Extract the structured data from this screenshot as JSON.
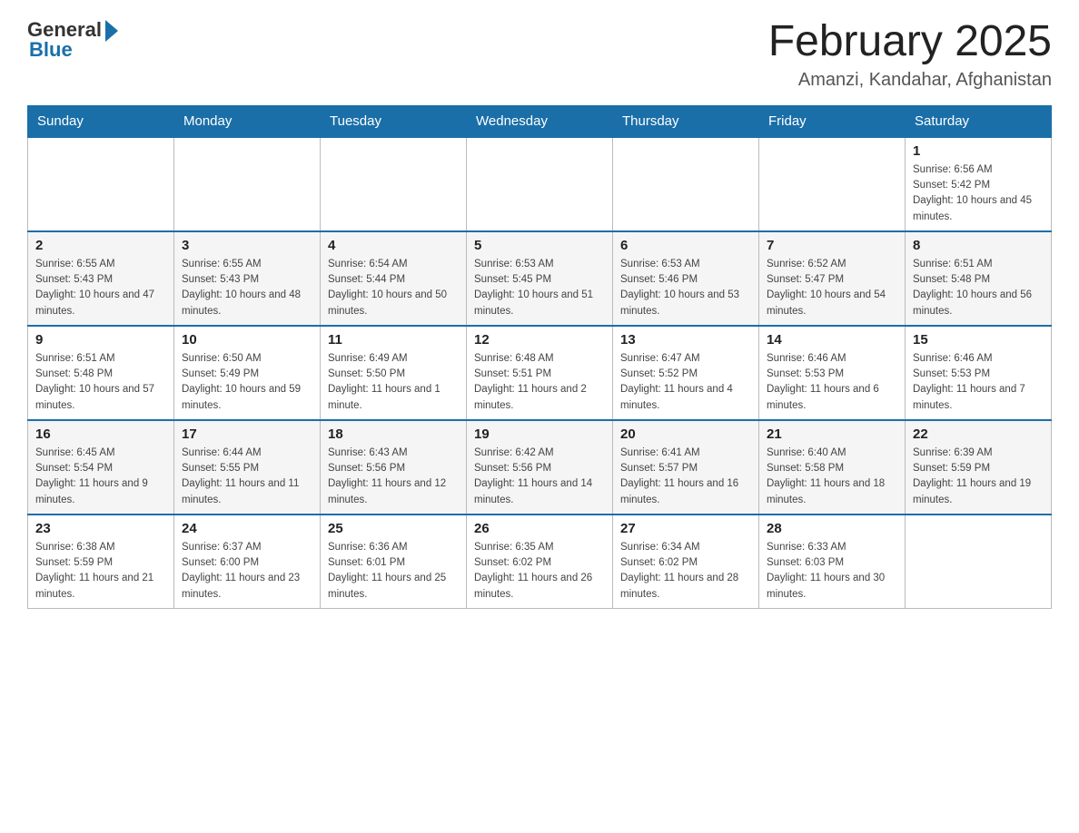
{
  "header": {
    "logo": {
      "general": "General",
      "blue": "Blue"
    },
    "title": "February 2025",
    "subtitle": "Amanzi, Kandahar, Afghanistan"
  },
  "days_of_week": [
    "Sunday",
    "Monday",
    "Tuesday",
    "Wednesday",
    "Thursday",
    "Friday",
    "Saturday"
  ],
  "weeks": [
    {
      "days": [
        {
          "number": "",
          "info": ""
        },
        {
          "number": "",
          "info": ""
        },
        {
          "number": "",
          "info": ""
        },
        {
          "number": "",
          "info": ""
        },
        {
          "number": "",
          "info": ""
        },
        {
          "number": "",
          "info": ""
        },
        {
          "number": "1",
          "info": "Sunrise: 6:56 AM\nSunset: 5:42 PM\nDaylight: 10 hours and 45 minutes."
        }
      ]
    },
    {
      "days": [
        {
          "number": "2",
          "info": "Sunrise: 6:55 AM\nSunset: 5:43 PM\nDaylight: 10 hours and 47 minutes."
        },
        {
          "number": "3",
          "info": "Sunrise: 6:55 AM\nSunset: 5:43 PM\nDaylight: 10 hours and 48 minutes."
        },
        {
          "number": "4",
          "info": "Sunrise: 6:54 AM\nSunset: 5:44 PM\nDaylight: 10 hours and 50 minutes."
        },
        {
          "number": "5",
          "info": "Sunrise: 6:53 AM\nSunset: 5:45 PM\nDaylight: 10 hours and 51 minutes."
        },
        {
          "number": "6",
          "info": "Sunrise: 6:53 AM\nSunset: 5:46 PM\nDaylight: 10 hours and 53 minutes."
        },
        {
          "number": "7",
          "info": "Sunrise: 6:52 AM\nSunset: 5:47 PM\nDaylight: 10 hours and 54 minutes."
        },
        {
          "number": "8",
          "info": "Sunrise: 6:51 AM\nSunset: 5:48 PM\nDaylight: 10 hours and 56 minutes."
        }
      ]
    },
    {
      "days": [
        {
          "number": "9",
          "info": "Sunrise: 6:51 AM\nSunset: 5:48 PM\nDaylight: 10 hours and 57 minutes."
        },
        {
          "number": "10",
          "info": "Sunrise: 6:50 AM\nSunset: 5:49 PM\nDaylight: 10 hours and 59 minutes."
        },
        {
          "number": "11",
          "info": "Sunrise: 6:49 AM\nSunset: 5:50 PM\nDaylight: 11 hours and 1 minute."
        },
        {
          "number": "12",
          "info": "Sunrise: 6:48 AM\nSunset: 5:51 PM\nDaylight: 11 hours and 2 minutes."
        },
        {
          "number": "13",
          "info": "Sunrise: 6:47 AM\nSunset: 5:52 PM\nDaylight: 11 hours and 4 minutes."
        },
        {
          "number": "14",
          "info": "Sunrise: 6:46 AM\nSunset: 5:53 PM\nDaylight: 11 hours and 6 minutes."
        },
        {
          "number": "15",
          "info": "Sunrise: 6:46 AM\nSunset: 5:53 PM\nDaylight: 11 hours and 7 minutes."
        }
      ]
    },
    {
      "days": [
        {
          "number": "16",
          "info": "Sunrise: 6:45 AM\nSunset: 5:54 PM\nDaylight: 11 hours and 9 minutes."
        },
        {
          "number": "17",
          "info": "Sunrise: 6:44 AM\nSunset: 5:55 PM\nDaylight: 11 hours and 11 minutes."
        },
        {
          "number": "18",
          "info": "Sunrise: 6:43 AM\nSunset: 5:56 PM\nDaylight: 11 hours and 12 minutes."
        },
        {
          "number": "19",
          "info": "Sunrise: 6:42 AM\nSunset: 5:56 PM\nDaylight: 11 hours and 14 minutes."
        },
        {
          "number": "20",
          "info": "Sunrise: 6:41 AM\nSunset: 5:57 PM\nDaylight: 11 hours and 16 minutes."
        },
        {
          "number": "21",
          "info": "Sunrise: 6:40 AM\nSunset: 5:58 PM\nDaylight: 11 hours and 18 minutes."
        },
        {
          "number": "22",
          "info": "Sunrise: 6:39 AM\nSunset: 5:59 PM\nDaylight: 11 hours and 19 minutes."
        }
      ]
    },
    {
      "days": [
        {
          "number": "23",
          "info": "Sunrise: 6:38 AM\nSunset: 5:59 PM\nDaylight: 11 hours and 21 minutes."
        },
        {
          "number": "24",
          "info": "Sunrise: 6:37 AM\nSunset: 6:00 PM\nDaylight: 11 hours and 23 minutes."
        },
        {
          "number": "25",
          "info": "Sunrise: 6:36 AM\nSunset: 6:01 PM\nDaylight: 11 hours and 25 minutes."
        },
        {
          "number": "26",
          "info": "Sunrise: 6:35 AM\nSunset: 6:02 PM\nDaylight: 11 hours and 26 minutes."
        },
        {
          "number": "27",
          "info": "Sunrise: 6:34 AM\nSunset: 6:02 PM\nDaylight: 11 hours and 28 minutes."
        },
        {
          "number": "28",
          "info": "Sunrise: 6:33 AM\nSunset: 6:03 PM\nDaylight: 11 hours and 30 minutes."
        },
        {
          "number": "",
          "info": ""
        }
      ]
    }
  ]
}
